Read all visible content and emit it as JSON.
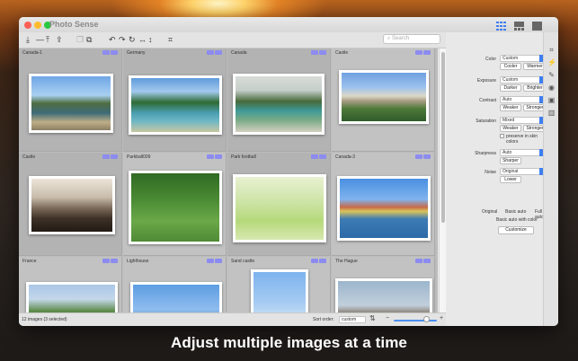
{
  "app": {
    "title": "Photo Sense"
  },
  "caption": "Adjust multiple images at a time",
  "toolbar": {
    "icons": [
      "import-icon",
      "minus-icon",
      "export-icon",
      "export-all-icon",
      "duplicate-icon",
      "copy-icon",
      "undo-icon",
      "redo-icon",
      "rotate-icon",
      "flip-horizontal-icon",
      "flip-vertical-icon",
      "crop-icon"
    ],
    "search_placeholder": "Search"
  },
  "grid": {
    "cells": [
      {
        "label": "Canada-1",
        "selected": true
      },
      {
        "label": "Germany",
        "selected": true
      },
      {
        "label": "Canada",
        "selected": true
      },
      {
        "label": "Castle",
        "selected": false
      },
      {
        "label": "Castle",
        "selected": true
      },
      {
        "label": "Parkball009",
        "selected": false
      },
      {
        "label": "Park football",
        "selected": true
      },
      {
        "label": "Canada-3",
        "selected": false
      },
      {
        "label": "France",
        "selected": false
      },
      {
        "label": "Lighthouse",
        "selected": false
      },
      {
        "label": "Sand castle",
        "selected": false
      },
      {
        "label": "The Hague",
        "selected": false
      }
    ]
  },
  "status": {
    "count_text": "12 images (3 selected)",
    "sort_label": "Sort order:",
    "sort_value": "custom",
    "zoom_minus": "−",
    "zoom_plus": "+",
    "zoom_level": 0.75
  },
  "panel": {
    "color_label": "Color",
    "color_value": "Custom",
    "cooler": "Cooler",
    "warmer": "Warmer",
    "exposure_label": "Exposure",
    "exposure_value": "Custom",
    "darker": "Darker",
    "brighter": "Brighter",
    "contrast_label": "Contrast",
    "contrast_value": "Auto",
    "weaker": "Weaker",
    "stronger": "Stronger",
    "saturation_label": "Saturation",
    "saturation_value": "Mixed",
    "sat_weaker": "Weaker",
    "sat_stronger": "Stronger",
    "preserve_skin": "preserve in skin colors",
    "sharpness_label": "Sharpness",
    "sharpness_value": "Auto",
    "sharper": "Sharper",
    "noise_label": "Noise",
    "noise_value": "Original",
    "lower": "Lower",
    "original": "Original",
    "basic_auto": "Basic auto",
    "full_auto": "Full auto",
    "basic_auto_color": "Basic auto with color",
    "customize": "Customize"
  },
  "colors": {
    "accent": "#3d7ef0",
    "selection": "#8c8cf0"
  }
}
